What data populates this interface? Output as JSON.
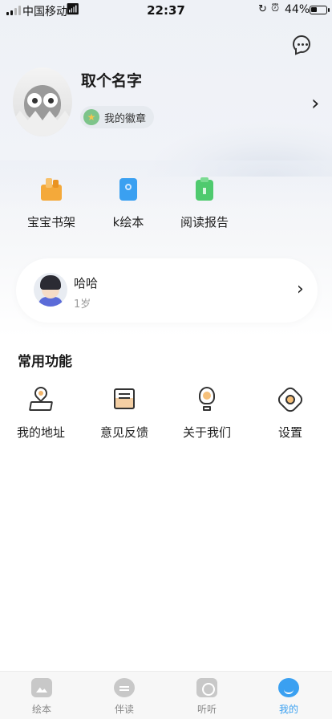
{
  "status_bar": {
    "carrier": "中国移动",
    "time": "22:37",
    "battery": "44%",
    "battery_level": 0.44
  },
  "header": {
    "message_icon": "chat-bubble-icon"
  },
  "profile": {
    "name": "取个名字",
    "badge_label": "我的徽章",
    "badge_icon": "star-medal-icon"
  },
  "shortcuts": [
    {
      "label": "宝宝书架",
      "icon": "bookshelf-icon",
      "color": "#f4a93a"
    },
    {
      "label": "k绘本",
      "icon": "picture-book-icon",
      "color": "#3aa0f1"
    },
    {
      "label": "阅读报告",
      "icon": "report-icon",
      "color": "#4fca6e"
    }
  ],
  "child": {
    "name": "哈哈",
    "age": "1岁"
  },
  "common": {
    "title": "常用功能",
    "items": [
      {
        "label": "我的地址",
        "icon": "location-pin-icon"
      },
      {
        "label": "意见反馈",
        "icon": "feedback-envelope-icon"
      },
      {
        "label": "关于我们",
        "icon": "lightbulb-icon"
      },
      {
        "label": "设置",
        "icon": "settings-gear-icon"
      }
    ]
  },
  "tabbar": {
    "tabs": [
      {
        "label": "绘本",
        "icon": "picture-book-tab-icon",
        "active": false
      },
      {
        "label": "伴读",
        "icon": "companion-read-tab-icon",
        "active": false
      },
      {
        "label": "听听",
        "icon": "listen-tab-icon",
        "active": false
      },
      {
        "label": "我的",
        "icon": "profile-tab-icon",
        "active": true
      }
    ],
    "active_color": "#3aa0f1"
  }
}
